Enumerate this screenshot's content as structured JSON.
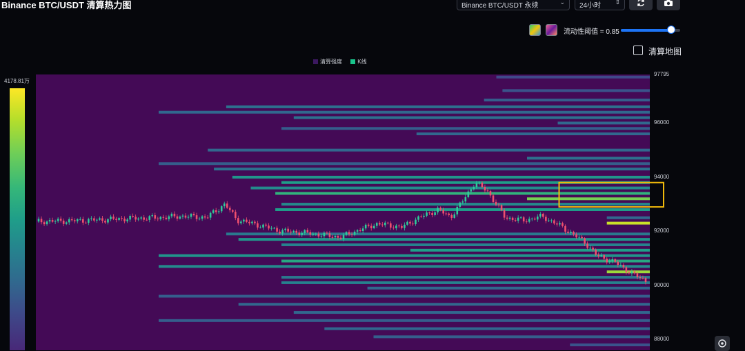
{
  "header": {
    "title": "Binance BTC/USDT 清算热力图",
    "pair_select": "Binance BTC/USDT 永续",
    "range_select": "24小时"
  },
  "toolbar": {
    "refresh_icon": "refresh-icon",
    "camera_icon": "camera-icon"
  },
  "controls": {
    "liquidity_label": "流动性阈值 = 0.85",
    "liquidity_value": 0.85,
    "map_checkbox_label": "清算地图",
    "map_checked": false
  },
  "legend": {
    "intensity_label": "清算强度",
    "kline_label": "K线",
    "intensity_color": "#3b1860",
    "kline_color": "#19c48c"
  },
  "colorbar": {
    "max_label": "4178.81万"
  },
  "colors": {
    "background": "#440a56",
    "highlight_box": "#f0b90b",
    "up_candle": "#2ecc9a",
    "down_candle": "#f0506e",
    "slider_fill": "#1d74f5"
  },
  "chart_data": {
    "type": "heatmap",
    "y_axis_ticks": [
      "97795",
      "96000",
      "94000",
      "92000",
      "90000",
      "88000"
    ],
    "ylim": [
      87600,
      97795
    ],
    "price_path": [
      [
        0,
        92360
      ],
      [
        0.05,
        92380
      ],
      [
        0.1,
        92420
      ],
      [
        0.15,
        92470
      ],
      [
        0.2,
        92500
      ],
      [
        0.24,
        92560
      ],
      [
        0.28,
        92510
      ],
      [
        0.31,
        93000
      ],
      [
        0.33,
        92420
      ],
      [
        0.36,
        92260
      ],
      [
        0.4,
        92020
      ],
      [
        0.45,
        91920
      ],
      [
        0.5,
        91780
      ],
      [
        0.53,
        92050
      ],
      [
        0.56,
        92280
      ],
      [
        0.6,
        92150
      ],
      [
        0.63,
        92520
      ],
      [
        0.66,
        92800
      ],
      [
        0.68,
        92520
      ],
      [
        0.7,
        93120
      ],
      [
        0.72,
        93800
      ],
      [
        0.74,
        93500
      ],
      [
        0.77,
        92500
      ],
      [
        0.8,
        92400
      ],
      [
        0.83,
        92550
      ],
      [
        0.86,
        92200
      ],
      [
        0.88,
        91900
      ],
      [
        0.9,
        91600
      ],
      [
        0.92,
        91100
      ],
      [
        0.95,
        90850
      ],
      [
        0.98,
        90400
      ],
      [
        1.0,
        90180
      ]
    ],
    "liquidation_bands": [
      {
        "price": 97700,
        "start": 0.75,
        "intensity": 0.15
      },
      {
        "price": 97200,
        "start": 0.76,
        "intensity": 0.2
      },
      {
        "price": 96850,
        "start": 0.73,
        "intensity": 0.25
      },
      {
        "price": 96600,
        "start": 0.31,
        "intensity": 0.35
      },
      {
        "price": 96400,
        "start": 0.2,
        "intensity": 0.3
      },
      {
        "price": 96200,
        "start": 0.42,
        "intensity": 0.35
      },
      {
        "price": 96000,
        "start": 0.85,
        "intensity": 0.3
      },
      {
        "price": 95800,
        "start": 0.4,
        "intensity": 0.25
      },
      {
        "price": 95600,
        "start": 0.62,
        "intensity": 0.3
      },
      {
        "price": 95000,
        "start": 0.28,
        "intensity": 0.3
      },
      {
        "price": 94700,
        "start": 0.8,
        "intensity": 0.35
      },
      {
        "price": 94500,
        "start": 0.2,
        "intensity": 0.25
      },
      {
        "price": 94300,
        "start": 0.29,
        "intensity": 0.35
      },
      {
        "price": 94000,
        "start": 0.32,
        "intensity": 0.55
      },
      {
        "price": 93800,
        "start": 0.4,
        "intensity": 0.6
      },
      {
        "price": 93600,
        "start": 0.35,
        "intensity": 0.5
      },
      {
        "price": 93400,
        "start": 0.39,
        "intensity": 0.7
      },
      {
        "price": 93200,
        "start": 0.8,
        "intensity": 0.85
      },
      {
        "price": 93000,
        "start": 0.4,
        "intensity": 0.5
      },
      {
        "price": 92800,
        "start": 0.39,
        "intensity": 0.6
      },
      {
        "price": 92500,
        "start": 0.93,
        "intensity": 0.3
      },
      {
        "price": 92300,
        "start": 0.93,
        "intensity": 0.95
      },
      {
        "price": 91900,
        "start": 0.31,
        "intensity": 0.4
      },
      {
        "price": 91700,
        "start": 0.33,
        "intensity": 0.55
      },
      {
        "price": 91500,
        "start": 0.4,
        "intensity": 0.45
      },
      {
        "price": 91300,
        "start": 0.61,
        "intensity": 0.6
      },
      {
        "price": 91100,
        "start": 0.2,
        "intensity": 0.55
      },
      {
        "price": 90900,
        "start": 0.4,
        "intensity": 0.65
      },
      {
        "price": 90700,
        "start": 0.2,
        "intensity": 0.5
      },
      {
        "price": 90500,
        "start": 0.93,
        "intensity": 0.9
      },
      {
        "price": 90300,
        "start": 0.4,
        "intensity": 0.4
      },
      {
        "price": 90100,
        "start": 0.4,
        "intensity": 0.45
      },
      {
        "price": 89900,
        "start": 0.54,
        "intensity": 0.3
      },
      {
        "price": 89600,
        "start": 0.2,
        "intensity": 0.25
      },
      {
        "price": 89300,
        "start": 0.33,
        "intensity": 0.3
      },
      {
        "price": 89000,
        "start": 0.42,
        "intensity": 0.3
      },
      {
        "price": 88700,
        "start": 0.2,
        "intensity": 0.25
      },
      {
        "price": 88400,
        "start": 0.47,
        "intensity": 0.3
      },
      {
        "price": 88100,
        "start": 0.55,
        "intensity": 0.25
      },
      {
        "price": 87800,
        "start": 0.87,
        "intensity": 0.2
      }
    ],
    "highlight_zone": {
      "price_low": 92900,
      "price_high": 93800,
      "x_start": 0.85
    }
  }
}
